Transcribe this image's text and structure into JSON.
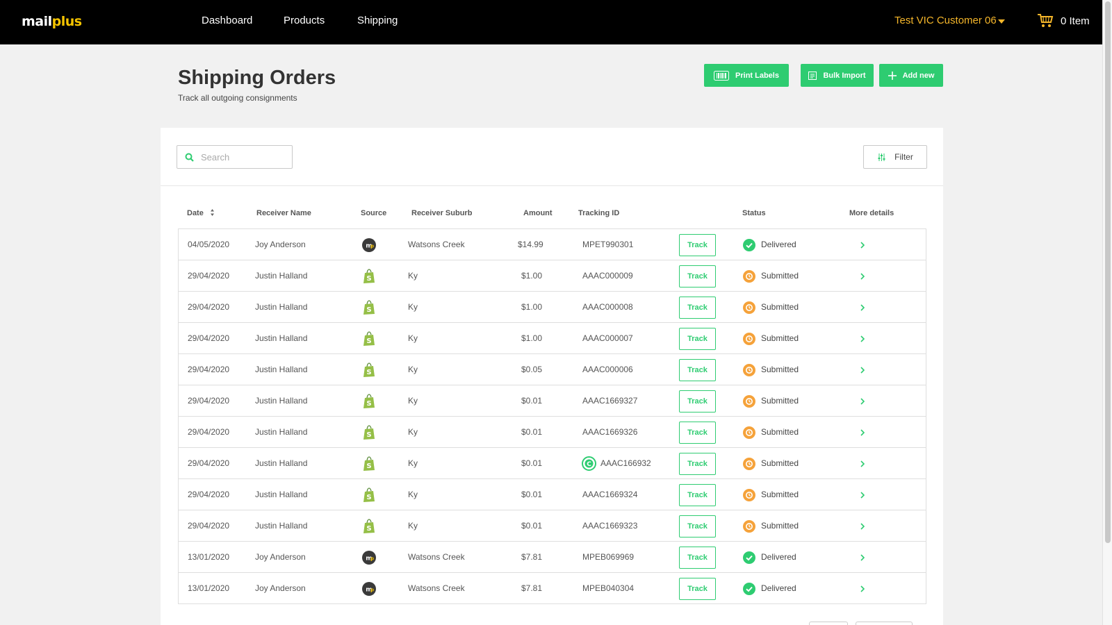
{
  "brand": {
    "logo_main": "mail",
    "logo_accent": "plus"
  },
  "nav": {
    "items": [
      {
        "label": "Dashboard"
      },
      {
        "label": "Products"
      },
      {
        "label": "Shipping"
      }
    ]
  },
  "user": {
    "name": "Test VIC Customer 06"
  },
  "cart": {
    "label": "0 Item"
  },
  "page": {
    "title": "Shipping Orders",
    "subtitle": "Track all outgoing consignments"
  },
  "actions": {
    "print_labels": "Print Labels",
    "bulk_import": "Bulk Import",
    "add_new": "Add new"
  },
  "search": {
    "placeholder": "Search"
  },
  "filter": {
    "label": "Filter"
  },
  "table": {
    "headers": {
      "date": "Date",
      "receiver": "Receiver Name",
      "source": "Source",
      "suburb": "Receiver Suburb",
      "amount": "Amount",
      "tracking": "Tracking ID",
      "status": "Status",
      "details": "More details"
    },
    "track_label": "Track",
    "rows": [
      {
        "date": "04/05/2020",
        "name": "Joy Anderson",
        "source": "mailplus-icon",
        "suburb": "Watsons Creek",
        "amount": "$14.99",
        "tracking": "MPET990301",
        "status": "Delivered"
      },
      {
        "date": "29/04/2020",
        "name": "Justin Halland",
        "source": "shopify-icon",
        "suburb": "Ky",
        "amount": "$1.00",
        "tracking": "AAAC000009",
        "status": "Submitted"
      },
      {
        "date": "29/04/2020",
        "name": "Justin Halland",
        "source": "shopify-icon",
        "suburb": "Ky",
        "amount": "$1.00",
        "tracking": "AAAC000008",
        "status": "Submitted"
      },
      {
        "date": "29/04/2020",
        "name": "Justin Halland",
        "source": "shopify-icon",
        "suburb": "Ky",
        "amount": "$1.00",
        "tracking": "AAAC000007",
        "status": "Submitted"
      },
      {
        "date": "29/04/2020",
        "name": "Justin Halland",
        "source": "shopify-icon",
        "suburb": "Ky",
        "amount": "$0.05",
        "tracking": "AAAC000006",
        "status": "Submitted"
      },
      {
        "date": "29/04/2020",
        "name": "Justin Halland",
        "source": "shopify-icon",
        "suburb": "Ky",
        "amount": "$0.01",
        "tracking": "AAAC1669327",
        "status": "Submitted"
      },
      {
        "date": "29/04/2020",
        "name": "Justin Halland",
        "source": "shopify-icon",
        "suburb": "Ky",
        "amount": "$0.01",
        "tracking": "AAAC1669326",
        "status": "Submitted"
      },
      {
        "date": "29/04/2020",
        "name": "Justin Halland",
        "source": "shopify-icon",
        "suburb": "Ky",
        "amount": "$0.01",
        "tracking": "AAAC166932",
        "status": "Submitted",
        "tracking_icon": "c-icon"
      },
      {
        "date": "29/04/2020",
        "name": "Justin Halland",
        "source": "shopify-icon",
        "suburb": "Ky",
        "amount": "$0.01",
        "tracking": "AAAC1669324",
        "status": "Submitted"
      },
      {
        "date": "29/04/2020",
        "name": "Justin Halland",
        "source": "shopify-icon",
        "suburb": "Ky",
        "amount": "$0.01",
        "tracking": "AAAC1669323",
        "status": "Submitted"
      },
      {
        "date": "13/01/2020",
        "name": "Joy Anderson",
        "source": "mailplus-icon",
        "suburb": "Watsons Creek",
        "amount": "$7.81",
        "tracking": "MPEB069969",
        "status": "Delivered"
      },
      {
        "date": "13/01/2020",
        "name": "Joy Anderson",
        "source": "mailplus-icon",
        "suburb": "Watsons Creek",
        "amount": "$7.81",
        "tracking": "MPEB040304",
        "status": "Delivered"
      }
    ]
  },
  "colors": {
    "accent_green": "#2ecc71",
    "submitted_orange": "#f5a23a",
    "header_bg": "#000000",
    "user_gold": "#f5b62a"
  }
}
